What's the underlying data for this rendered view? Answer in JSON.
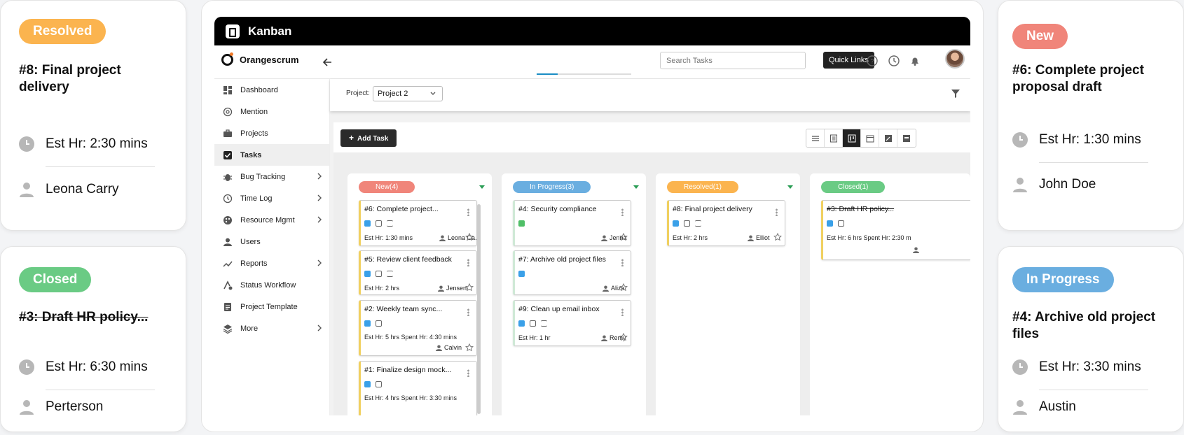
{
  "promo_left_top": {
    "badge": "Resolved",
    "badge_color": "#fbb44f",
    "title": "#8: Final project delivery",
    "est": "Est Hr: 2:30 mins",
    "user": "Leona Carry"
  },
  "promo_left_bottom": {
    "badge": "Closed",
    "badge_color": "#6acb84",
    "title": "#3: Draft HR policy...",
    "est": "Est Hr: 6:30 mins",
    "user": "Perterson"
  },
  "promo_right_top": {
    "badge": "New",
    "badge_color": "#f0857a",
    "title": "#6: Complete project proposal draft",
    "est": "Est Hr: 1:30 mins",
    "user": "John Doe"
  },
  "promo_right_bottom": {
    "badge": "In Progress",
    "badge_color": "#6aaee0",
    "title": "#4: Archive old project files",
    "est": "Est Hr: 3:30 mins",
    "user": "Austin"
  },
  "app": {
    "window_title": "Kanban",
    "brand": "Orangescrum",
    "search_placeholder": "Search Tasks",
    "quick_links": "Quick Links",
    "project_label": "Project:",
    "project_value": "Project 2",
    "add_task": "Add Task"
  },
  "sidebar": {
    "items": [
      {
        "label": "Dashboard",
        "icon": "dashboard-icon"
      },
      {
        "label": "Mention",
        "icon": "at-icon"
      },
      {
        "label": "Projects",
        "icon": "briefcase-icon"
      },
      {
        "label": "Tasks",
        "icon": "checkbox-icon",
        "active": true
      },
      {
        "label": "Bug Tracking",
        "icon": "bug-icon",
        "submenu": true
      },
      {
        "label": "Time Log",
        "icon": "clock-icon",
        "submenu": true
      },
      {
        "label": "Resource Mgmt",
        "icon": "palette-icon",
        "submenu": true
      },
      {
        "label": "Users",
        "icon": "user-icon"
      },
      {
        "label": "Reports",
        "icon": "trend-icon",
        "submenu": true
      },
      {
        "label": "Status Workflow",
        "icon": "workflow-icon"
      },
      {
        "label": "Project Template",
        "icon": "template-icon"
      },
      {
        "label": "More",
        "icon": "layers-icon",
        "submenu": true
      }
    ]
  },
  "columns": [
    {
      "header": "New(4)",
      "color": "#f0857a",
      "cards": [
        {
          "id": "#6:",
          "title": "Complete project...",
          "meta": "Est Hr: 1:30 mins",
          "user": "Leona Ca..."
        },
        {
          "id": "#5:",
          "title": "Review client feedback",
          "meta": "Est Hr: 2 hrs",
          "user": "Jensen"
        },
        {
          "id": "#2:",
          "title": "Weekly team sync...",
          "meta": "Est Hr: 5 hrs   Spent Hr: 4:30 mins",
          "user": "Calvin"
        },
        {
          "id": "#1:",
          "title": "Finalize design mock...",
          "meta": "Est Hr: 4 hrs   Spent Hr: 3:30 mins",
          "user": ""
        }
      ]
    },
    {
      "header": "In Progress(3)",
      "color": "#6aaee0",
      "cards": [
        {
          "id": "#4:",
          "title": "Security compliance",
          "meta": "",
          "user": "Jenna"
        },
        {
          "id": "#7:",
          "title": "Archive old project files",
          "meta": "",
          "user": "Aliza"
        },
        {
          "id": "#9:",
          "title": "Clean up email inbox",
          "meta": "Est Hr: 1 hr",
          "user": "Remy"
        }
      ]
    },
    {
      "header": "Resolved(1)",
      "color": "#fbb44f",
      "cards": [
        {
          "id": "#8:",
          "title": "Final project delivery",
          "meta": "Est Hr: 2 hrs",
          "user": "Elliot"
        }
      ]
    },
    {
      "header": "Closed(1)",
      "color": "#6acb84",
      "cards": [
        {
          "id": "#3:",
          "title": "Draft HR policy...",
          "meta": "Est Hr: 6 hrs   Spent Hr: 2:30 m",
          "user": ""
        }
      ]
    }
  ]
}
